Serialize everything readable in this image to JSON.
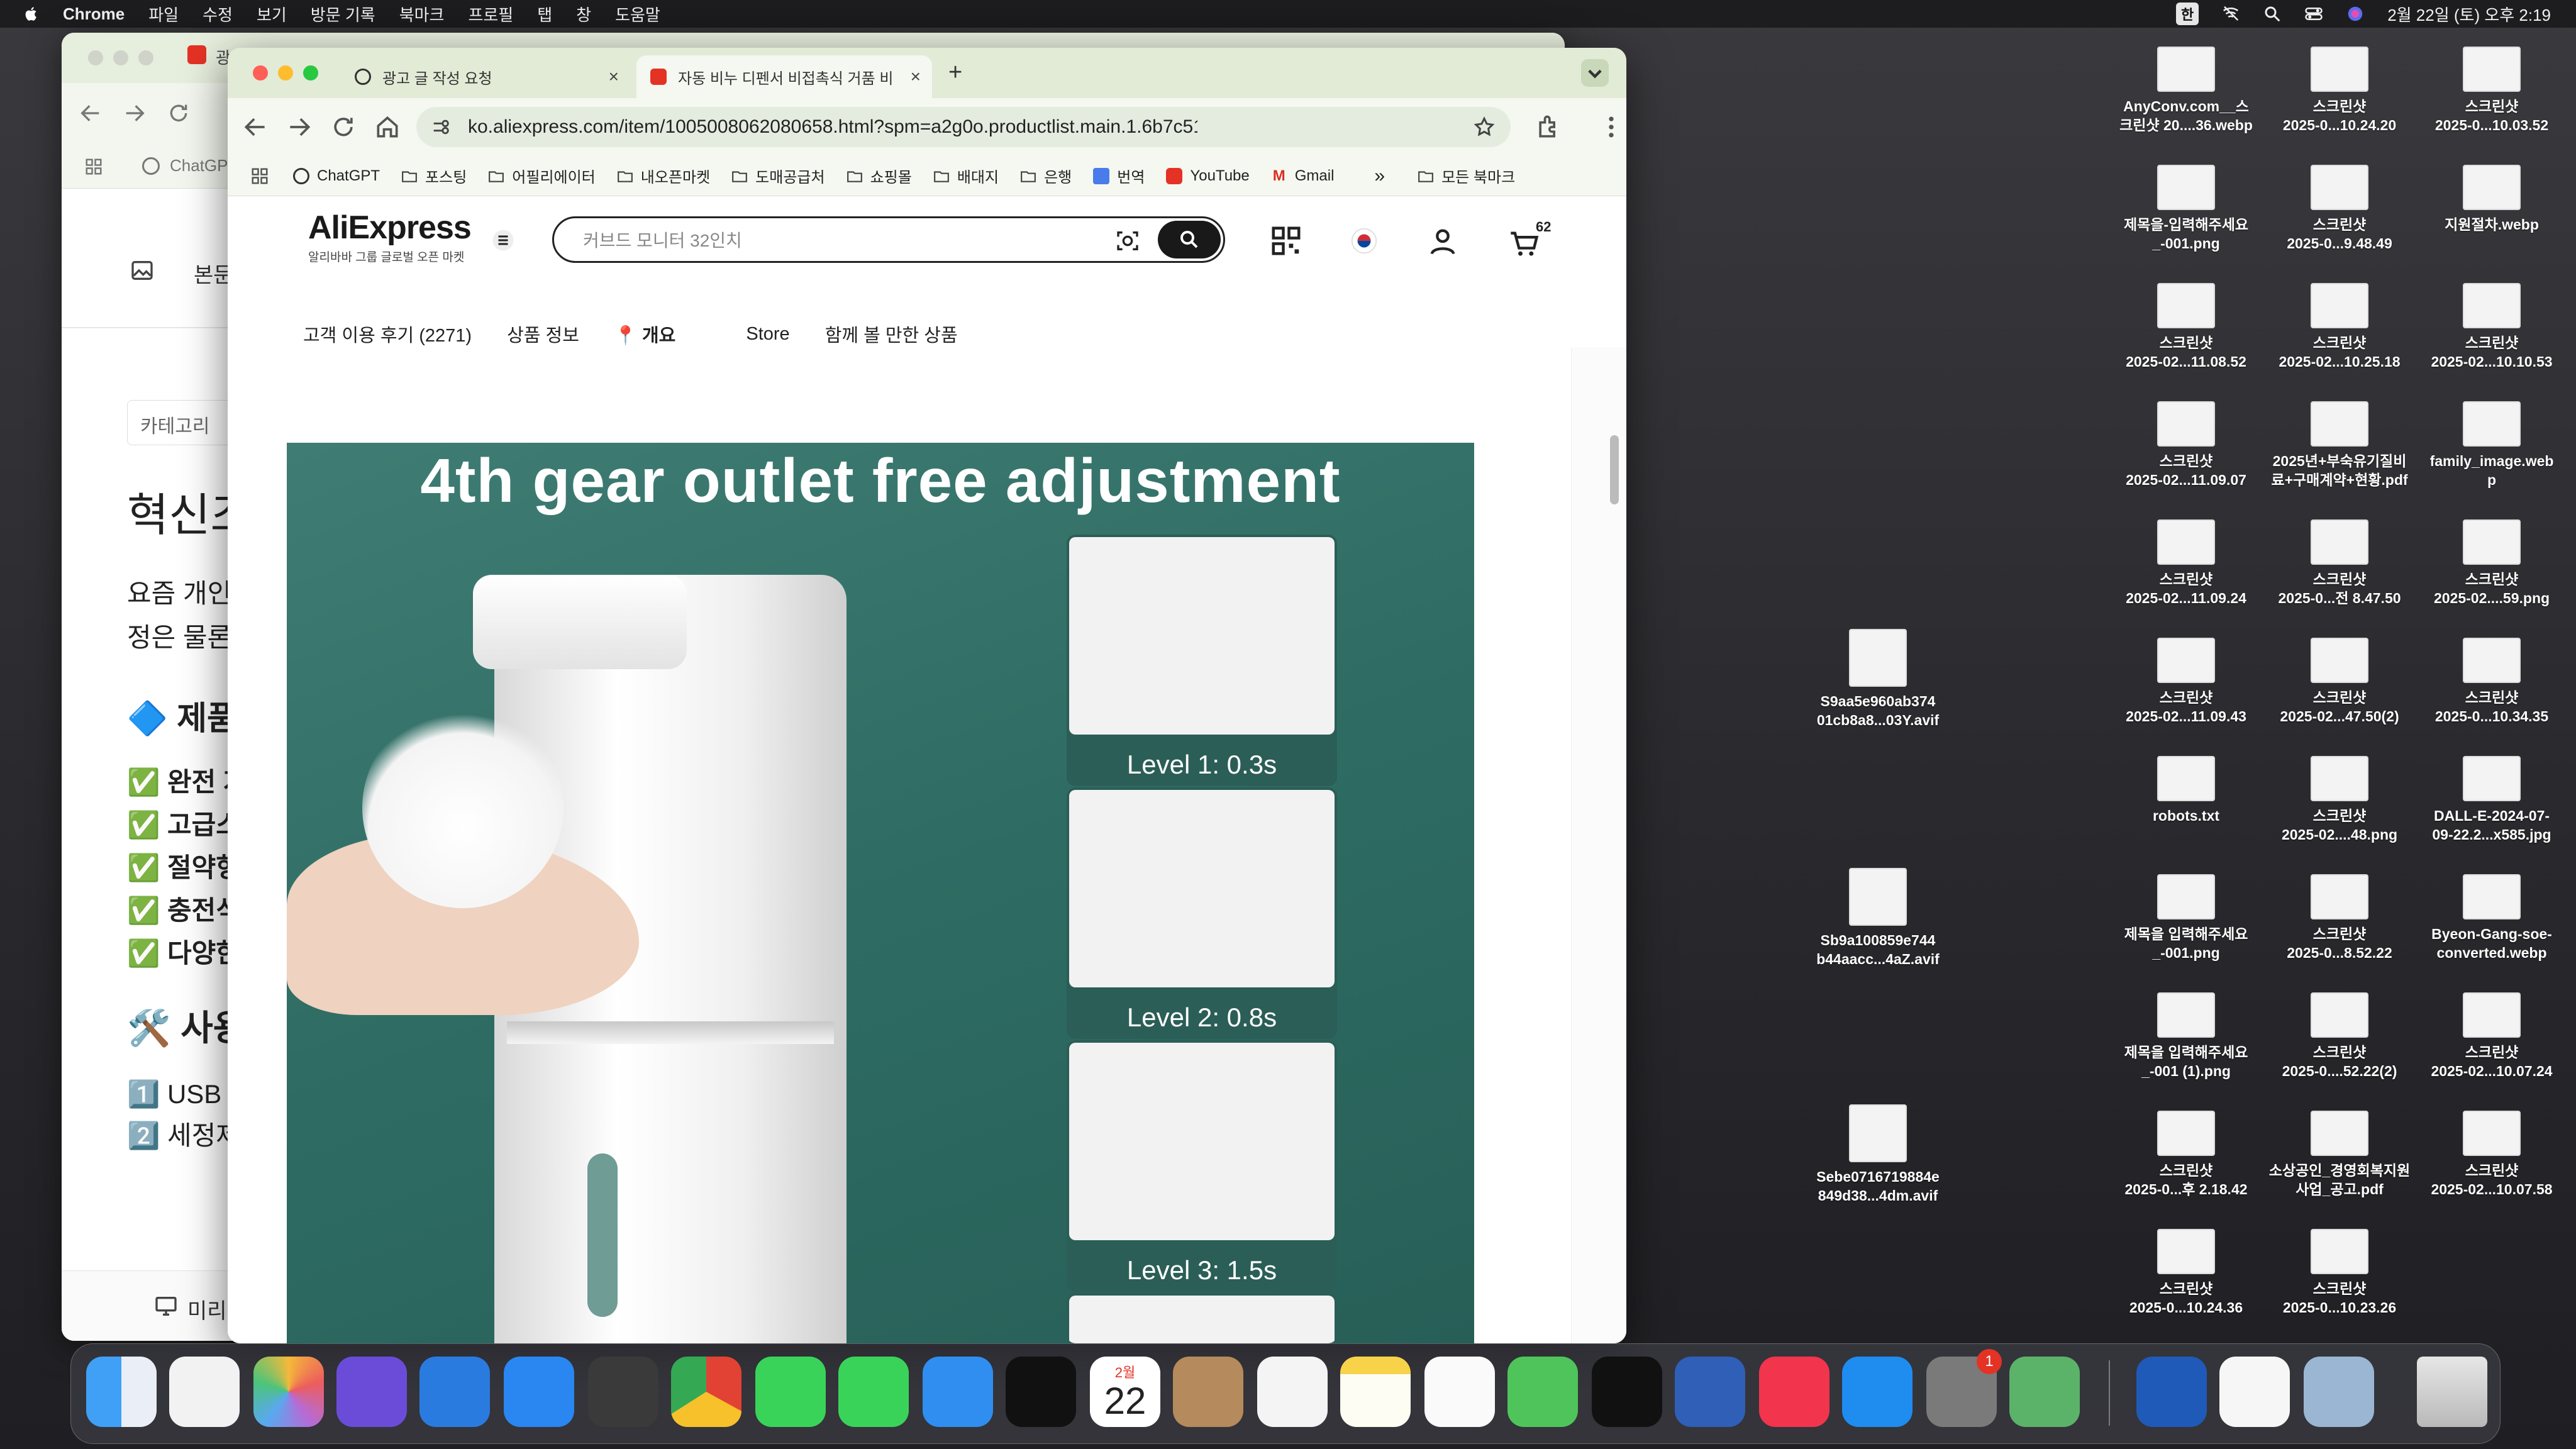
{
  "menubar": {
    "app": "Chrome",
    "menus": [
      "파일",
      "수정",
      "보기",
      "방문 기록",
      "북마크",
      "프로필",
      "탭",
      "창",
      "도움말"
    ],
    "input_mode": "한",
    "datetime": "2월 22일 (토) 오후 2:19"
  },
  "back_window": {
    "tab_label": "광",
    "bookmark_label": "ChatGP",
    "toolbar_text": "본문",
    "category_placeholder": "카테고리",
    "heading": "혁신조",
    "para_line1": "요즘 개인",
    "para_line2": "정은 물론(",
    "section": "🔷 제품",
    "checks": [
      "✅ 완전 지",
      "✅ 고급스",
      "✅ 절약형",
      "✅ 충전식",
      "✅ 다양한"
    ],
    "usage_heading": "🛠️ 사용",
    "steps": [
      "1️⃣ USB 카",
      "2️⃣ 세정제"
    ],
    "preview_label": "미리"
  },
  "front_window": {
    "tabs": [
      {
        "label": "광고 글 작성 요청",
        "active": false
      },
      {
        "label": "자동 비누 디펜서 비접촉식 거품 비",
        "active": true
      }
    ],
    "url": "ko.aliexpress.com/item/1005008062080658.html?spm=a2g0o.productlist.main.1.6b7c51f...",
    "bookmarks": [
      "ChatGPT",
      "포스팅",
      "어필리에이터",
      "내오픈마켓",
      "도매공급처",
      "쇼핑몰",
      "배대지",
      "은행",
      "번역",
      "YouTube",
      "Gmail"
    ],
    "all_bookmarks": "모든 북마크",
    "colors": {
      "accent": "#e43225",
      "tabbar": "#e2ebd6"
    }
  },
  "page": {
    "logo_text": "AliExpress",
    "logo_sub": "알리바바 그룹 글로벌 오픈 마켓",
    "search_placeholder": "커브드 모니터 32인치",
    "cart_count": "62",
    "nav": [
      "고객 이용 후기 (2271)",
      "상품 정보",
      "개요",
      "Store",
      "함께 볼 만한 상품"
    ],
    "banner": {
      "headline": "4th gear outlet free adjustment",
      "levels": [
        "Level 1: 0.3s",
        "Level 2: 0.8s",
        "Level 3: 1.5s"
      ],
      "color": "#2f6e65"
    }
  },
  "desktop_icons": [
    {
      "line1": "AnyConv.com__스",
      "line2": "크린샷 20....36.webp"
    },
    {
      "line1": "스크린샷",
      "line2": "2025-0...10.24.20"
    },
    {
      "line1": "스크린샷",
      "line2": "2025-0...10.03.52"
    },
    {
      "line1": "제목을-입력해주세요",
      "line2": "_-001.png"
    },
    {
      "line1": "스크린샷",
      "line2": "2025-0...9.48.49"
    },
    {
      "line1": "지원절차.webp",
      "line2": ""
    },
    {
      "line1": "스크린샷",
      "line2": "2025-02...11.08.52"
    },
    {
      "line1": "스크린샷",
      "line2": "2025-02...10.25.18"
    },
    {
      "line1": "스크린샷",
      "line2": "2025-02...10.10.53"
    },
    {
      "line1": "스크린샷",
      "line2": "2025-02...11.09.07"
    },
    {
      "line1": "2025년+부숙유기질비",
      "line2": "료+구매계약+현황.pdf"
    },
    {
      "line1": "family_image.web",
      "line2": "p"
    },
    {
      "line1": "스크린샷",
      "line2": "2025-02...11.09.24"
    },
    {
      "line1": "스크린샷",
      "line2": "2025-0...전 8.47.50"
    },
    {
      "line1": "스크린샷",
      "line2": "2025-02....59.png"
    },
    {
      "line1": "스크린샷",
      "line2": "2025-02...11.09.43"
    },
    {
      "line1": "스크린샷",
      "line2": "2025-02...47.50(2)"
    },
    {
      "line1": "스크린샷",
      "line2": "2025-0...10.34.35"
    },
    {
      "line1": "robots.txt",
      "line2": ""
    },
    {
      "line1": "스크린샷",
      "line2": "2025-02....48.png"
    },
    {
      "line1": "DALL-E-2024-07-",
      "line2": "09-22.2...x585.jpg"
    },
    {
      "line1": "제목을 입력해주세요",
      "line2": "_-001.png"
    },
    {
      "line1": "스크린샷",
      "line2": "2025-0...8.52.22"
    },
    {
      "line1": "Byeon-Gang-soe-",
      "line2": "converted.webp"
    },
    {
      "line1": "제목을 입력해주세요",
      "line2": "_-001 (1).png"
    },
    {
      "line1": "스크린샷",
      "line2": "2025-0....52.22(2)"
    },
    {
      "line1": "스크린샷",
      "line2": "2025-02...10.07.24"
    },
    {
      "line1": "스크린샷",
      "line2": "2025-0...후 2.18.42"
    },
    {
      "line1": "소상공인_경영회복지원",
      "line2": "사업_공고.pdf"
    },
    {
      "line1": "스크린샷",
      "line2": "2025-02...10.07.58"
    },
    {
      "line1": "스크린샷",
      "line2": "2025-0...10.24.36"
    },
    {
      "line1": "스크린샷",
      "line2": "2025-0...10.23.26"
    },
    {
      "line1": "S9aa5e960ab374",
      "line2": "01cb8a8...03Y.avif"
    },
    {
      "line1": "Sb9a100859e744",
      "line2": "b44aacc...4aZ.avif"
    },
    {
      "line1": "Sebe0716719884e",
      "line2": "849d38...4dm.avif"
    }
  ],
  "dock": {
    "calendar_month": "2월",
    "calendar_day": "22",
    "settings_badge": "1"
  }
}
